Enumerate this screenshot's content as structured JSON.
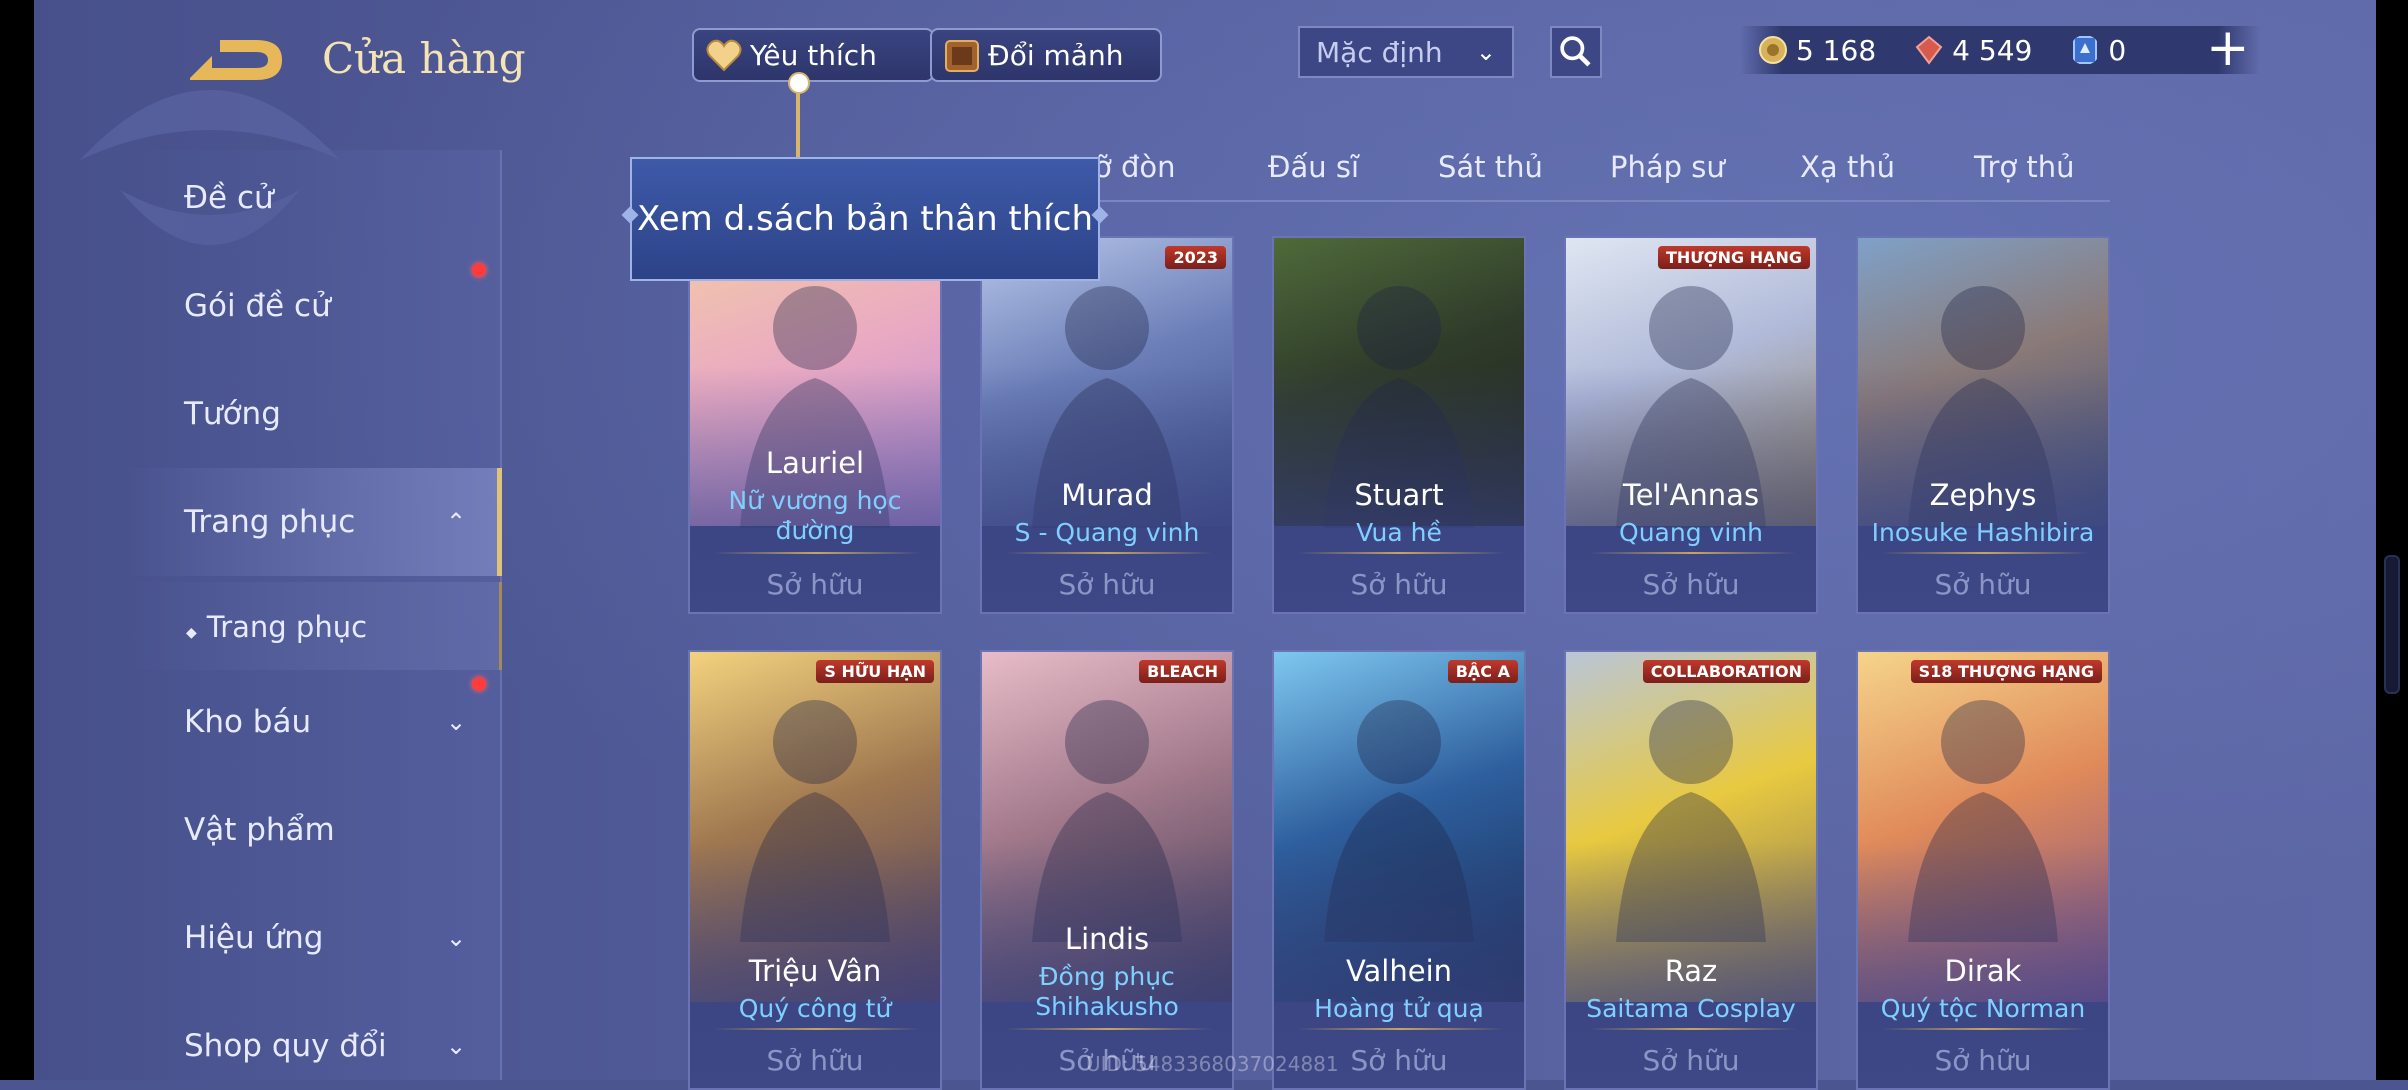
{
  "header": {
    "title": "Cửa hàng",
    "favorites_label": "Yêu thích",
    "shards_label": "Đổi mảnh",
    "sort_value": "Mặc định",
    "currencies": [
      {
        "icon": "gold-coin-icon",
        "value": "5 168",
        "color": "#d8b25a"
      },
      {
        "icon": "ruby-icon",
        "value": "4 549",
        "color": "#d65a4e"
      },
      {
        "icon": "voucher-icon",
        "value": "0",
        "color": "#7fb6ff"
      }
    ]
  },
  "tooltip": {
    "text": "Xem d.sách bản thân thích"
  },
  "sidebar": {
    "items": [
      {
        "label": "Đề cử"
      },
      {
        "label": "Gói đề cử"
      },
      {
        "label": "Tướng"
      },
      {
        "label": "Trang phục"
      },
      {
        "label": "Trang phục"
      },
      {
        "label": "Kho báu"
      },
      {
        "label": "Vật phẩm"
      },
      {
        "label": "Hiệu ứng"
      },
      {
        "label": "Shop quy đổi"
      }
    ]
  },
  "tabs": [
    {
      "label": "ỡ đòn"
    },
    {
      "label": "Đấu sĩ"
    },
    {
      "label": "Sát thủ"
    },
    {
      "label": "Pháp sư"
    },
    {
      "label": "Xạ thủ"
    },
    {
      "label": "Trợ thủ"
    }
  ],
  "cards": [
    {
      "name": "Lauriel",
      "skin": "Nữ vương học",
      "skin2": "đường",
      "owned": "Sở hữu",
      "badge": "",
      "colors": [
        "#f3c9a8",
        "#e9a9c3",
        "#b98bd6"
      ]
    },
    {
      "name": "Murad",
      "skin": "S - Quang vinh",
      "skin2": "",
      "owned": "Sở hữu",
      "badge": "2023",
      "colors": [
        "#b7c6e8",
        "#6c7fb8",
        "#3b4b86"
      ]
    },
    {
      "name": "Stuart",
      "skin": "Vua hề",
      "skin2": "",
      "owned": "Sở hữu",
      "badge": "",
      "colors": [
        "#4f6a3a",
        "#2f3b2a",
        "#1e2220"
      ]
    },
    {
      "name": "Tel'Annas",
      "skin": "Quang vinh",
      "skin2": "",
      "owned": "Sở hữu",
      "badge": "THƯỢNG HẠNG",
      "colors": [
        "#dfe6f2",
        "#b0b9d8",
        "#8a7a52"
      ]
    },
    {
      "name": "Zephys",
      "skin": "Inosuke Hashibira",
      "skin2": "",
      "owned": "Sở hữu",
      "badge": "",
      "colors": [
        "#7fa1c8",
        "#8a7a78",
        "#3c4a76"
      ]
    },
    {
      "name": "Triệu Vân",
      "skin": "Quý công tử",
      "skin2": "",
      "owned": "Sở hữu",
      "badge": "S HỮU HẠN",
      "colors": [
        "#f3d27e",
        "#a07850",
        "#4c3b5c"
      ]
    },
    {
      "name": "Lindis",
      "skin": "Đồng phục",
      "skin2": "Shihakusho",
      "owned": "Sở hữu",
      "badge": "BLEACH",
      "colors": [
        "#e8bcc8",
        "#a0788a",
        "#3b3552"
      ]
    },
    {
      "name": "Valhein",
      "skin": "Hoàng tử quạ",
      "skin2": "",
      "owned": "Sở hữu",
      "badge": "BẬC A",
      "colors": [
        "#7ec8f0",
        "#2e5f9e",
        "#182a52"
      ]
    },
    {
      "name": "Raz",
      "skin": "Saitama Cosplay",
      "skin2": "",
      "owned": "Sở hữu",
      "badge": "COLLABORATION",
      "colors": [
        "#b9c6d8",
        "#e8c940",
        "#7a6a5a"
      ]
    },
    {
      "name": "Dirak",
      "skin": "Quý tộc Norman",
      "skin2": "",
      "owned": "Sở hữu",
      "badge": "S18 THƯỢNG HẠNG",
      "colors": [
        "#f5d48a",
        "#e08a5a",
        "#7a4f8a"
      ]
    }
  ],
  "footer": {
    "uid": "UID: 5483368037024881"
  }
}
